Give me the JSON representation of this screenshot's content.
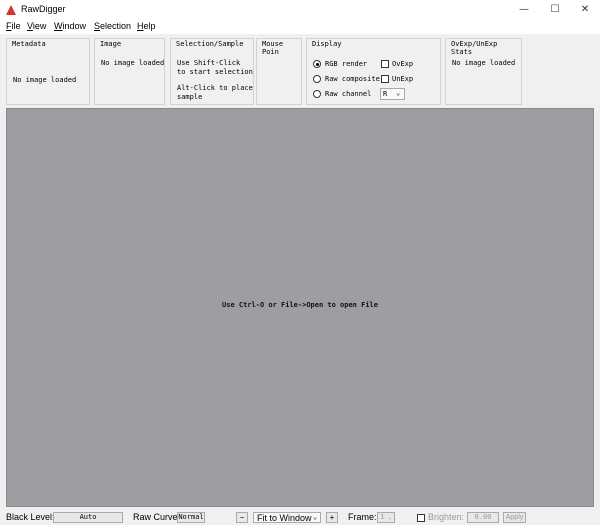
{
  "window": {
    "title": "RawDigger",
    "min_glyph": "—",
    "max_glyph": "☐",
    "close_glyph": "✕"
  },
  "menu": [
    "File",
    "View",
    "Window",
    "Selection",
    "Help"
  ],
  "panels": {
    "metadata": {
      "title": "Metadata",
      "text": "No image loaded"
    },
    "image": {
      "title": "Image",
      "text": "No image loaded"
    },
    "selection": {
      "title": "Selection/Sample",
      "line1": "Use Shift-Click",
      "line2": "to start selection",
      "line3": "Alt-Click to place",
      "line4": "sample"
    },
    "mouse": {
      "title": "Mouse Poin"
    },
    "display": {
      "title": "Display",
      "rgb_render": "RGB render",
      "raw_composite": "Raw composite",
      "raw_channel": "Raw channel",
      "overexp": "OvExp",
      "underexp": "UnExp",
      "channel_value": "R"
    },
    "stats": {
      "title": "OvExp/UnExp Stats",
      "text": "No image loaded"
    }
  },
  "canvas": {
    "message": "Use Ctrl-O or File->Open to open File"
  },
  "statusbar": {
    "black_level_label": "Black Level:",
    "black_level_value": "Auto",
    "raw_curve_label": "Raw Curve:",
    "raw_curve_value": "Normal",
    "zoom_out": "−",
    "zoom_mode": "Fit to Window",
    "zoom_in": "+",
    "frame_label": "Frame:",
    "frame_value": "1",
    "brighten_label": "Brighten:",
    "brighten_value": "0.00",
    "apply_label": "Apply"
  }
}
